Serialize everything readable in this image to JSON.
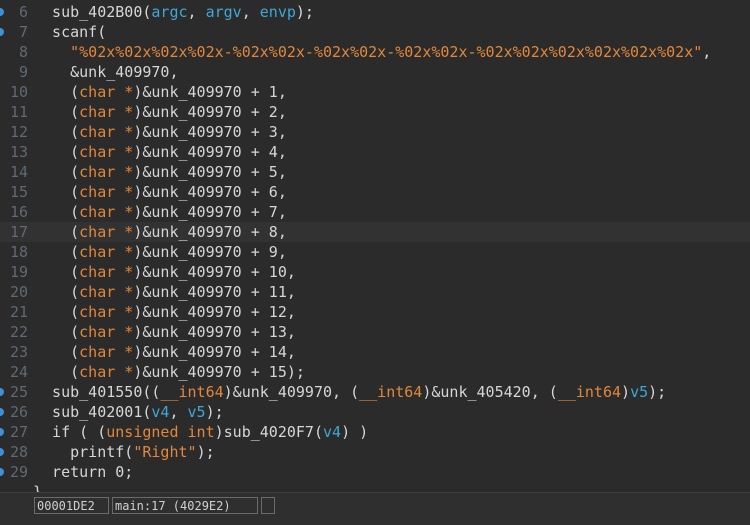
{
  "editor": {
    "current_line": "17",
    "lines": [
      {
        "num": "6",
        "marker": true,
        "tokens": [
          {
            "t": "  sub_402B00(",
            "c": "pl"
          },
          {
            "t": "argc",
            "c": "var"
          },
          {
            "t": ", ",
            "c": "pl"
          },
          {
            "t": "argv",
            "c": "var"
          },
          {
            "t": ", ",
            "c": "pl"
          },
          {
            "t": "envp",
            "c": "var"
          },
          {
            "t": ");",
            "c": "pl"
          }
        ]
      },
      {
        "num": "7",
        "marker": true,
        "tokens": [
          {
            "t": "  scanf(",
            "c": "pl"
          }
        ]
      },
      {
        "num": "8",
        "marker": false,
        "tokens": [
          {
            "t": "    ",
            "c": "pl"
          },
          {
            "t": "\"%02x%02x%02x%02x-%02x%02x-%02x%02x-%02x%02x-%02x%02x%02x%02x%02x%02x\"",
            "c": "str"
          },
          {
            "t": ",",
            "c": "pl"
          }
        ]
      },
      {
        "num": "9",
        "marker": false,
        "tokens": [
          {
            "t": "    &unk_409970,",
            "c": "pl"
          }
        ]
      },
      {
        "num": "10",
        "marker": false,
        "tokens": [
          {
            "t": "    (",
            "c": "pl"
          },
          {
            "t": "char *",
            "c": "kw"
          },
          {
            "t": ")&unk_409970 + 1,",
            "c": "pl"
          }
        ]
      },
      {
        "num": "11",
        "marker": false,
        "tokens": [
          {
            "t": "    (",
            "c": "pl"
          },
          {
            "t": "char *",
            "c": "kw"
          },
          {
            "t": ")&unk_409970 + 2,",
            "c": "pl"
          }
        ]
      },
      {
        "num": "12",
        "marker": false,
        "tokens": [
          {
            "t": "    (",
            "c": "pl"
          },
          {
            "t": "char *",
            "c": "kw"
          },
          {
            "t": ")&unk_409970 + 3,",
            "c": "pl"
          }
        ]
      },
      {
        "num": "13",
        "marker": false,
        "tokens": [
          {
            "t": "    (",
            "c": "pl"
          },
          {
            "t": "char *",
            "c": "kw"
          },
          {
            "t": ")&unk_409970 + 4,",
            "c": "pl"
          }
        ]
      },
      {
        "num": "14",
        "marker": false,
        "tokens": [
          {
            "t": "    (",
            "c": "pl"
          },
          {
            "t": "char *",
            "c": "kw"
          },
          {
            "t": ")&unk_409970 + 5,",
            "c": "pl"
          }
        ]
      },
      {
        "num": "15",
        "marker": false,
        "tokens": [
          {
            "t": "    (",
            "c": "pl"
          },
          {
            "t": "char *",
            "c": "kw"
          },
          {
            "t": ")&unk_409970 + 6,",
            "c": "pl"
          }
        ]
      },
      {
        "num": "16",
        "marker": false,
        "tokens": [
          {
            "t": "    (",
            "c": "pl"
          },
          {
            "t": "char *",
            "c": "kw"
          },
          {
            "t": ")&unk_409970 + 7,",
            "c": "pl"
          }
        ]
      },
      {
        "num": "17",
        "marker": false,
        "tokens": [
          {
            "t": "    (",
            "c": "pl"
          },
          {
            "t": "char *",
            "c": "kw"
          },
          {
            "t": ")&unk_409970 + 8,",
            "c": "pl"
          }
        ]
      },
      {
        "num": "18",
        "marker": false,
        "tokens": [
          {
            "t": "    (",
            "c": "pl"
          },
          {
            "t": "char *",
            "c": "kw"
          },
          {
            "t": ")&unk_409970 + 9,",
            "c": "pl"
          }
        ]
      },
      {
        "num": "19",
        "marker": false,
        "tokens": [
          {
            "t": "    (",
            "c": "pl"
          },
          {
            "t": "char *",
            "c": "kw"
          },
          {
            "t": ")&unk_409970 + 10,",
            "c": "pl"
          }
        ]
      },
      {
        "num": "20",
        "marker": false,
        "tokens": [
          {
            "t": "    (",
            "c": "pl"
          },
          {
            "t": "char *",
            "c": "kw"
          },
          {
            "t": ")&unk_409970 + 11,",
            "c": "pl"
          }
        ]
      },
      {
        "num": "21",
        "marker": false,
        "tokens": [
          {
            "t": "    (",
            "c": "pl"
          },
          {
            "t": "char *",
            "c": "kw"
          },
          {
            "t": ")&unk_409970 + 12,",
            "c": "pl"
          }
        ]
      },
      {
        "num": "22",
        "marker": false,
        "tokens": [
          {
            "t": "    (",
            "c": "pl"
          },
          {
            "t": "char *",
            "c": "kw"
          },
          {
            "t": ")&unk_409970 + 13,",
            "c": "pl"
          }
        ]
      },
      {
        "num": "23",
        "marker": false,
        "tokens": [
          {
            "t": "    (",
            "c": "pl"
          },
          {
            "t": "char *",
            "c": "kw"
          },
          {
            "t": ")&unk_409970 + 14,",
            "c": "pl"
          }
        ]
      },
      {
        "num": "24",
        "marker": false,
        "tokens": [
          {
            "t": "    (",
            "c": "pl"
          },
          {
            "t": "char *",
            "c": "kw"
          },
          {
            "t": ")&unk_409970 + 15);",
            "c": "pl"
          }
        ]
      },
      {
        "num": "25",
        "marker": true,
        "tokens": [
          {
            "t": "  sub_401550((",
            "c": "pl"
          },
          {
            "t": "__int64",
            "c": "kw"
          },
          {
            "t": ")&unk_409970, (",
            "c": "pl"
          },
          {
            "t": "__int64",
            "c": "kw"
          },
          {
            "t": ")&unk_405420, (",
            "c": "pl"
          },
          {
            "t": "__int64",
            "c": "kw"
          },
          {
            "t": ")",
            "c": "pl"
          },
          {
            "t": "v5",
            "c": "var"
          },
          {
            "t": ");",
            "c": "pl"
          }
        ]
      },
      {
        "num": "26",
        "marker": true,
        "tokens": [
          {
            "t": "  sub_402001(",
            "c": "pl"
          },
          {
            "t": "v4",
            "c": "var"
          },
          {
            "t": ", ",
            "c": "pl"
          },
          {
            "t": "v5",
            "c": "var"
          },
          {
            "t": ");",
            "c": "pl"
          }
        ]
      },
      {
        "num": "27",
        "marker": true,
        "tokens": [
          {
            "t": "  if ( (",
            "c": "pl"
          },
          {
            "t": "unsigned int",
            "c": "kw"
          },
          {
            "t": ")sub_4020F7(",
            "c": "pl"
          },
          {
            "t": "v4",
            "c": "var"
          },
          {
            "t": ") )",
            "c": "pl"
          }
        ]
      },
      {
        "num": "28",
        "marker": true,
        "tokens": [
          {
            "t": "    printf(",
            "c": "pl"
          },
          {
            "t": "\"Right\"",
            "c": "str"
          },
          {
            "t": ");",
            "c": "pl"
          }
        ]
      },
      {
        "num": "29",
        "marker": true,
        "tokens": [
          {
            "t": "  return 0;",
            "c": "pl"
          }
        ]
      }
    ],
    "trailing_brace": "}"
  },
  "status": {
    "address": "00001DE2",
    "location": "main:17 (4029E2)",
    "extra": ""
  },
  "colors": {
    "background": "#2b2b2b",
    "plain": "#d6d6d6",
    "variable": "#3ea8d8",
    "string_keyword": "#e2873b",
    "line_number": "#5f6a72",
    "marker": "#3d8fd6"
  }
}
